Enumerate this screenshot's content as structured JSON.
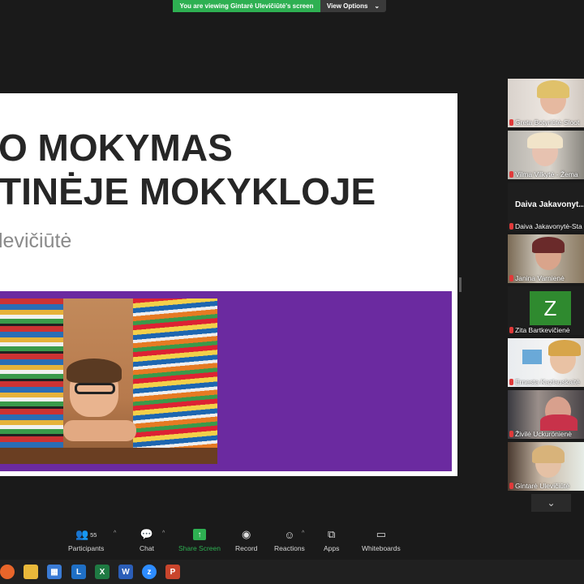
{
  "banner": {
    "text": "You are viewing Gintarė Ulevičiūtė's screen",
    "button": "View Options"
  },
  "slide": {
    "title_line1": "O MOKYMAS",
    "title_line2": "TINĖJE MOKYKLOJE",
    "subtitle": "levičiūtė",
    "band_color": "#6b2aa0"
  },
  "participants": [
    {
      "name": "Greta Botyriūtė-Sloot",
      "muted": true
    },
    {
      "name": "Vilma Vilkytė - Žema",
      "muted": true
    },
    {
      "name": "Daiva Jakavonytė-Sta",
      "display": "Daiva Jakavonyt...",
      "muted": true
    },
    {
      "name": "Janina Varnienė",
      "muted": true
    },
    {
      "name": "Zita Bartkevičienė",
      "avatar": "Z",
      "muted": true
    },
    {
      "name": "Ernesta Kazlauskaitė",
      "muted": true
    },
    {
      "name": "Živilė Uckurönienė",
      "muted": true
    },
    {
      "name": "Gintarė Ulevičiūtė",
      "muted": true,
      "active": true
    }
  ],
  "toolbar": {
    "participants": {
      "label": "Participants",
      "count": "55"
    },
    "chat": "Chat",
    "share": "Share Screen",
    "record": "Record",
    "reactions": "Reactions",
    "apps": "Apps",
    "whiteboards": "Whiteboards"
  },
  "colors": {
    "accent_green": "#2eb052",
    "active_speaker": "#e8e24a"
  },
  "taskbar": {
    "items": [
      "firefox-icon",
      "file-explorer-icon",
      "store-icon",
      "l-app-icon",
      "excel-icon",
      "word-icon",
      "zoom-icon",
      "powerpoint-icon"
    ]
  }
}
